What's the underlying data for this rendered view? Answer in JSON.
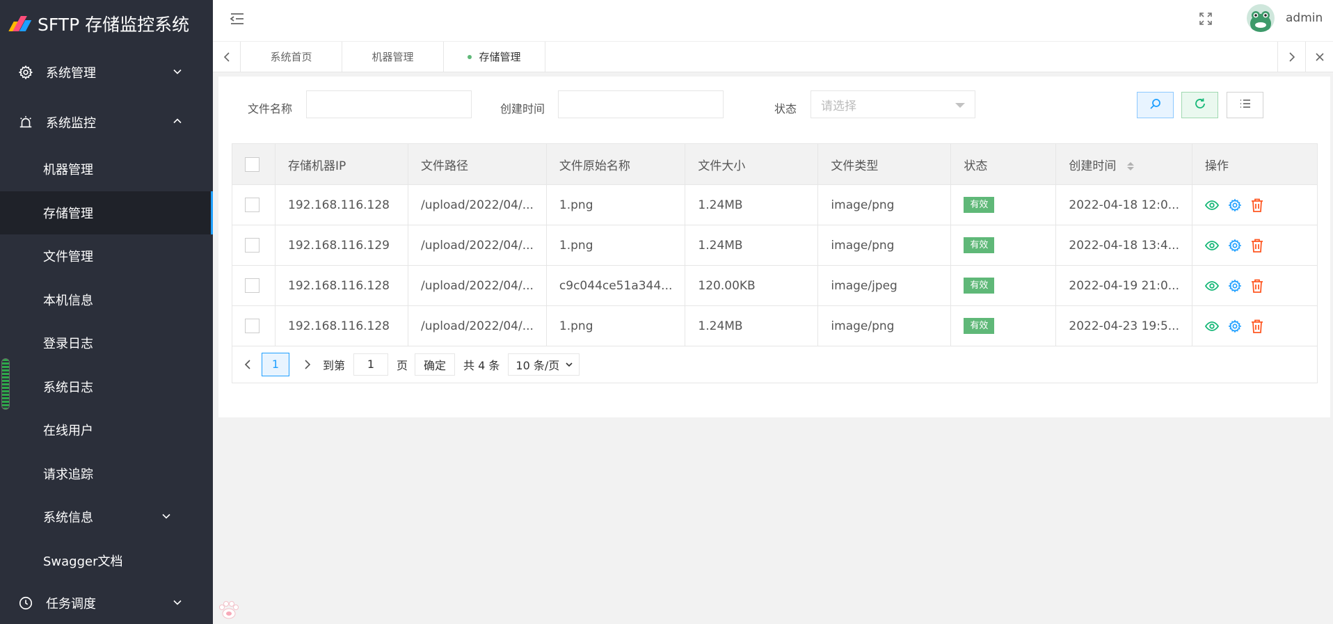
{
  "app": {
    "title": "SFTP 存储监控系统",
    "logo_colors": [
      "#ffb800",
      "#ff4d7a",
      "#1e9fff"
    ]
  },
  "sidebar": {
    "groups": [
      {
        "label": "系统管理",
        "icon": "gear-icon",
        "expanded": false
      },
      {
        "label": "系统监控",
        "icon": "alarm-icon",
        "expanded": true
      }
    ],
    "children": [
      {
        "label": "机器管理"
      },
      {
        "label": "存储管理",
        "active": true
      },
      {
        "label": "文件管理"
      },
      {
        "label": "本机信息"
      },
      {
        "label": "登录日志"
      },
      {
        "label": "系统日志"
      },
      {
        "label": "在线用户"
      },
      {
        "label": "请求追踪"
      },
      {
        "label": "系统信息",
        "has_children": true
      },
      {
        "label": "Swagger文档"
      }
    ],
    "bottom_group": {
      "label": "任务调度",
      "icon": "clock-icon"
    }
  },
  "header": {
    "menu_toggle_icon": "menu-fold-icon",
    "fullscreen_icon": "fullscreen-icon",
    "user": "admin"
  },
  "tabs": [
    {
      "label": "系统首页"
    },
    {
      "label": "机器管理"
    },
    {
      "label": "存储管理",
      "active": true
    }
  ],
  "filters": {
    "file_name_label": "文件名称",
    "file_name_value": "",
    "created_label": "创建时间",
    "created_value": "",
    "status_label": "状态",
    "status_placeholder": "请选择"
  },
  "toolbar": {
    "search_icon": "search-icon",
    "refresh_icon": "refresh-icon",
    "columns_icon": "list-icon"
  },
  "table": {
    "headers": {
      "ip": "存储机器IP",
      "path": "文件路径",
      "name": "文件原始名称",
      "size": "文件大小",
      "type": "文件类型",
      "status": "状态",
      "created": "创建时间",
      "ops": "操作"
    },
    "rows": [
      {
        "ip": "192.168.116.128",
        "path": "/upload/2022/04/...",
        "name": "1.png",
        "size": "1.24MB",
        "type": "image/png",
        "status": "有效",
        "created": "2022-04-18 12:0..."
      },
      {
        "ip": "192.168.116.129",
        "path": "/upload/2022/04/...",
        "name": "1.png",
        "size": "1.24MB",
        "type": "image/png",
        "status": "有效",
        "created": "2022-04-18 13:4..."
      },
      {
        "ip": "192.168.116.128",
        "path": "/upload/2022/04/...",
        "name": "c9c044ce51a344...",
        "size": "120.00KB",
        "type": "image/jpeg",
        "status": "有效",
        "created": "2022-04-19 21:0..."
      },
      {
        "ip": "192.168.116.128",
        "path": "/upload/2022/04/...",
        "name": "1.png",
        "size": "1.24MB",
        "type": "image/png",
        "status": "有效",
        "created": "2022-04-23 19:5..."
      }
    ]
  },
  "pager": {
    "current_page": "1",
    "goto_prefix": "到第",
    "goto_value": "1",
    "goto_suffix": "页",
    "confirm": "确定",
    "total": "共 4 条",
    "page_size": "10 条/页"
  },
  "colors": {
    "sidebar_bg": "#2b2f3a",
    "active_accent": "#1e9fff",
    "status_green": "#5fb878",
    "view_icon": "#16b777",
    "edit_icon": "#1e9fff",
    "delete_icon": "#ff5722"
  }
}
